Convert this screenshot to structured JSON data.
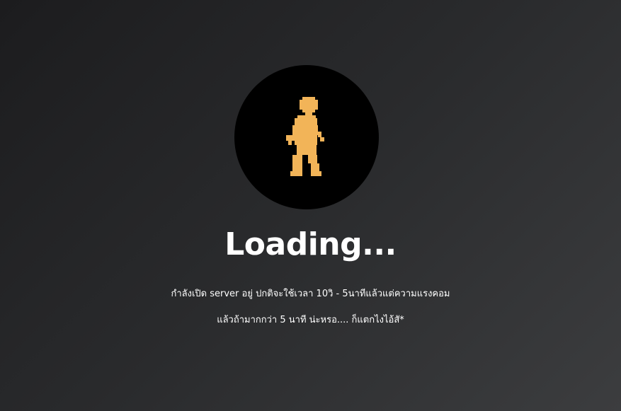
{
  "loader": {
    "icon": "walking-person-icon",
    "icon_color": "#f2b458",
    "circle_color": "#000000"
  },
  "title": "Loading...",
  "messages": {
    "line1": "กำลังเปิด server อยู่ ปกติจะใช้เวลา 10วิ - 5นาทีแล้วแต่ความแรงคอม",
    "line2": "แล้วถ้ามากกว่า 5 นาที น่ะหรอ.... ก็แตกไงไอ้สั*"
  }
}
